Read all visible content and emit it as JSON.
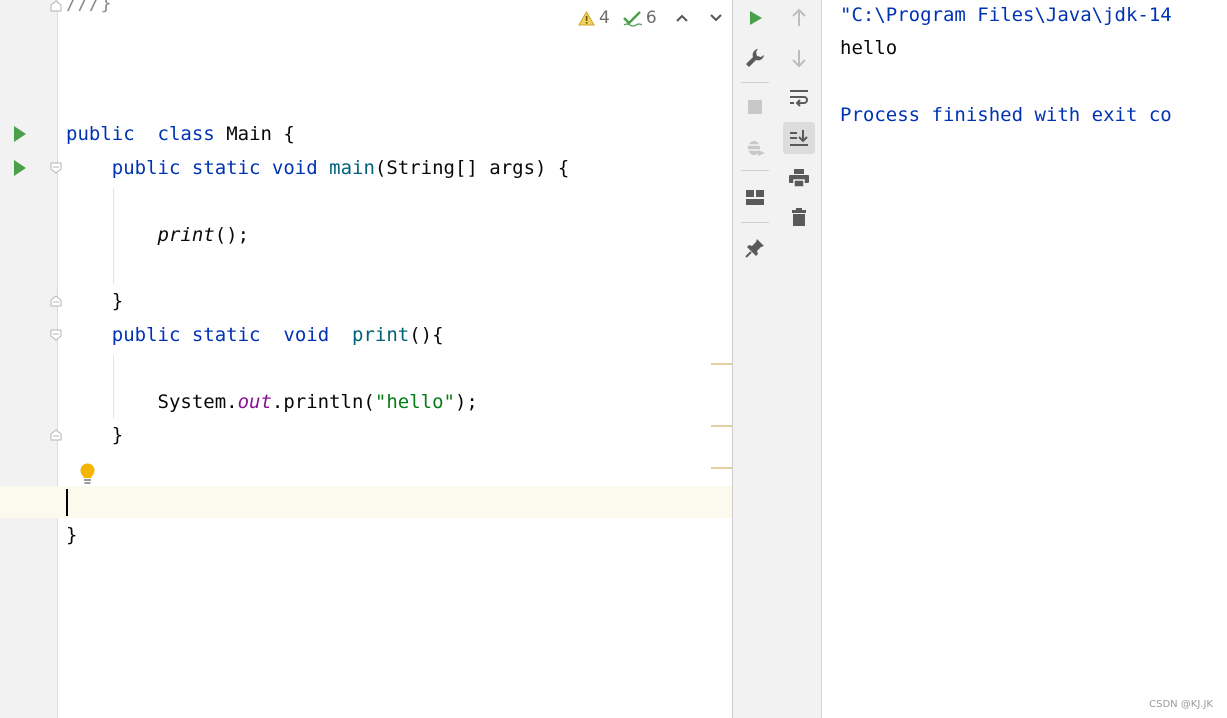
{
  "editor": {
    "top_fragment": "///}",
    "lines": {
      "class_decl": {
        "kw": "public",
        "kw2": "class",
        "name": "Main",
        "brace": "{"
      },
      "main_decl": {
        "kw": "public static void",
        "fn": "main",
        "params": "(String[] args) {"
      },
      "print_call": {
        "fn": "print",
        "rest": "();"
      },
      "close_main": "}",
      "print_decl": {
        "kw": "public static",
        "kw2": "void",
        "fn": "print",
        "rest": "(){"
      },
      "println": {
        "obj": "System.",
        "field": "out",
        "call": ".println(",
        "str": "\"hello\"",
        "end": ");"
      },
      "close_print": "}",
      "close_class": "}"
    }
  },
  "inspections": {
    "warnings": "4",
    "weak_warnings": "6",
    "warning_icon": "warning-triangle-icon",
    "check_icon": "check-icon"
  },
  "console": {
    "command": "\"C:\\Program Files\\Java\\jdk-14",
    "output": "hello",
    "exit_message": "Process finished with exit co"
  },
  "watermark": "CSDN @KJ.JK",
  "colors": {
    "keyword": "#0033b3",
    "function": "#00627a",
    "field": "#871094",
    "string": "#067d17",
    "run_green": "#4aa04a",
    "bulb": "#f4b400"
  }
}
